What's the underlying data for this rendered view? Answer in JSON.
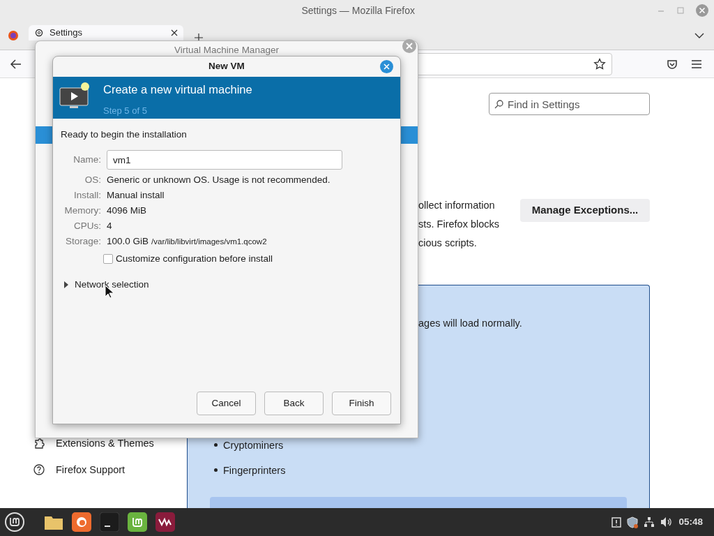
{
  "firefox": {
    "title": "Settings — Mozilla Firefox",
    "tab": {
      "label": "Settings",
      "selected": true
    },
    "search": {
      "placeholder": "Find in Settings"
    },
    "paragraph_lines": [
      "ollect information",
      "sts. Firefox blocks",
      "cious scripts."
    ],
    "manage_button": "Manage Exceptions...",
    "info_box": {
      "text": "ages will load normally.",
      "items": [
        "Cryptominers",
        "Fingerprinters"
      ]
    },
    "sidebar": {
      "items": [
        {
          "label": "Extensions & Themes",
          "kind": "extensions"
        },
        {
          "label": "Firefox Support",
          "kind": "support"
        }
      ]
    }
  },
  "vmm": {
    "title": "Virtual Machine Manager"
  },
  "dialog": {
    "title": "New VM",
    "header": {
      "title": "Create a new virtual machine",
      "subtitle": "Step 5 of 5"
    },
    "intro": "Ready to begin the installation",
    "fields": [
      {
        "label": "Name:",
        "value": "vm1",
        "kind": "input"
      },
      {
        "label": "OS:",
        "value": "Generic or unknown OS. Usage is not recommended.",
        "kind": "text"
      },
      {
        "label": "Install:",
        "value": "Manual install",
        "kind": "text"
      },
      {
        "label": "Memory:",
        "value": "4096 MiB",
        "kind": "text"
      },
      {
        "label": "CPUs:",
        "value": "4",
        "kind": "text"
      },
      {
        "label": "Storage:",
        "value": "100.0 GiB",
        "detail": "/var/lib/libvirt/images/vm1.qcow2",
        "kind": "storage"
      }
    ],
    "customize": {
      "label": "Customize configuration before install",
      "checked": false
    },
    "network": {
      "label": "Network selection",
      "expanded": false
    },
    "buttons": [
      "Cancel",
      "Back",
      "Finish"
    ]
  },
  "taskbar": {
    "clock": "05:48"
  }
}
